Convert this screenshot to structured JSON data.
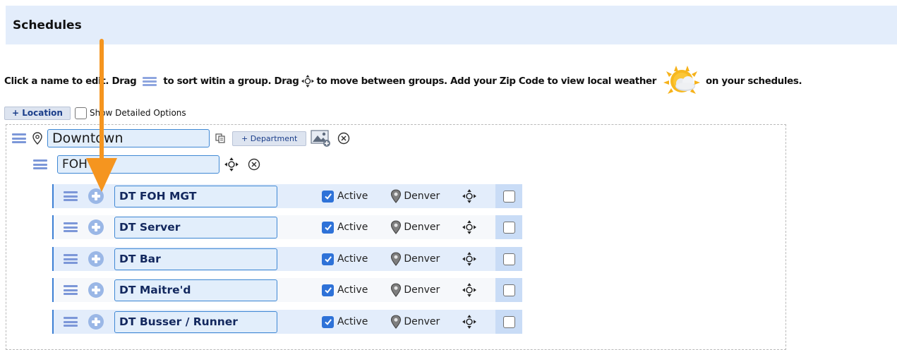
{
  "header": {
    "title": "Schedules"
  },
  "instructions": {
    "part1": "Click a name to edit. Drag",
    "drag_icon": "hamburger-icon",
    "part2": "to sort witin a group. Drag",
    "move_icon": "move-arrows-icon",
    "part3": "to move between groups. Add your Zip Code to view local weather",
    "weather_icon": "sun-cloud-icon",
    "part4": "on your schedules."
  },
  "location_bar": {
    "add_location_label": "+ Location",
    "show_detailed_label": "Show Detailed Options",
    "show_detailed_checked": false
  },
  "location": {
    "name": "Downtown",
    "add_department_label": "+ Department",
    "icons": [
      "location-pin-icon",
      "copy-icon",
      "image-add-icon",
      "delete-circle-icon"
    ]
  },
  "department": {
    "name": "FOH"
  },
  "schedules": [
    {
      "name": "DT FOH MGT",
      "active_label": "Active",
      "active": true,
      "location": "Denver",
      "selected": false
    },
    {
      "name": "DT Server",
      "active_label": "Active",
      "active": true,
      "location": "Denver",
      "selected": false
    },
    {
      "name": "DT Bar",
      "active_label": "Active",
      "active": true,
      "location": "Denver",
      "selected": false
    },
    {
      "name": "DT Maitre'd",
      "active_label": "Active",
      "active": true,
      "location": "Denver",
      "selected": false
    },
    {
      "name": "DT Busser / Runner",
      "active_label": "Active",
      "active": true,
      "location": "Denver",
      "selected": false
    }
  ],
  "annotation": {
    "arrow_color": "#f5951f"
  },
  "colors": {
    "header_bg": "#e3edfb",
    "accent": "#3f88d4",
    "checkbox_blue": "#2e72d8"
  }
}
